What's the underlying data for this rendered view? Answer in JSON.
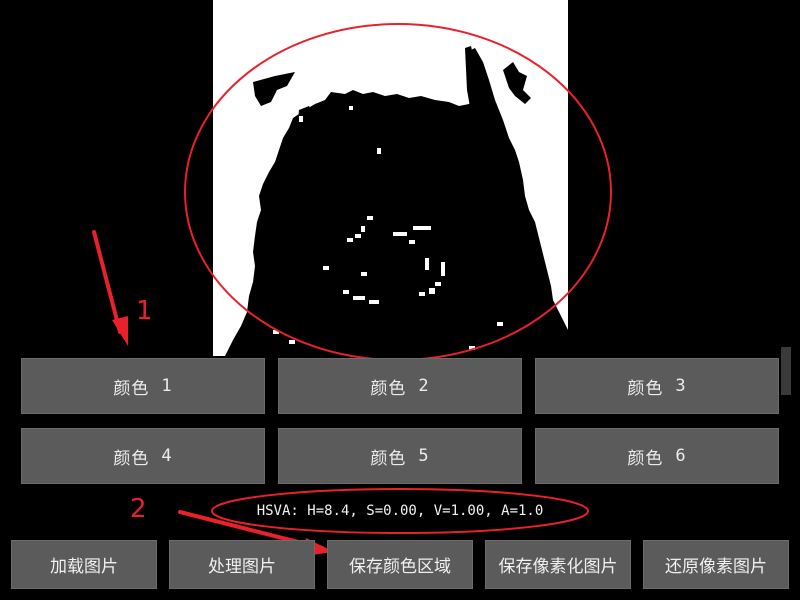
{
  "color_buttons": [
    {
      "label": "颜色",
      "index": "1"
    },
    {
      "label": "颜色",
      "index": "2"
    },
    {
      "label": "颜色",
      "index": "3"
    },
    {
      "label": "颜色",
      "index": "4"
    },
    {
      "label": "颜色",
      "index": "5"
    },
    {
      "label": "颜色",
      "index": "6"
    }
  ],
  "hsva_readout": "HSVA: H=8.4, S=0.00, V=1.00, A=1.0",
  "action_buttons": [
    {
      "label": "加载图片"
    },
    {
      "label": "处理图片"
    },
    {
      "label": "保存颜色区域"
    },
    {
      "label": "保存像素化图片"
    },
    {
      "label": "还原像素图片"
    }
  ],
  "annotations": {
    "marker_1": "1",
    "marker_2": "2",
    "color": "#e8212b"
  },
  "colors": {
    "background": "#000000",
    "button_bg": "#5b5b5b",
    "button_text": "#ececec",
    "preview_bg": "#ffffff",
    "pixel_art": "#000000"
  }
}
